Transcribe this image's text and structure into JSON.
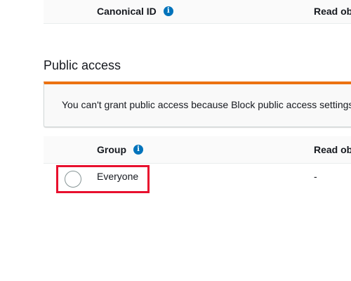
{
  "permissions_table": {
    "columns": [
      "Canonical ID",
      "Read obj"
    ]
  },
  "public_access": {
    "title": "Public access",
    "alert_text": "You can't grant public access because Block public access settings",
    "columns": [
      "Group",
      "Read obj"
    ],
    "rows": [
      {
        "group": "Everyone",
        "read_objects": "-"
      }
    ]
  },
  "colors": {
    "alert_accent": "#ec7211",
    "info_icon": "#0073bb",
    "highlight_box": "#e8102e"
  },
  "icons": {
    "info": "info-icon"
  }
}
